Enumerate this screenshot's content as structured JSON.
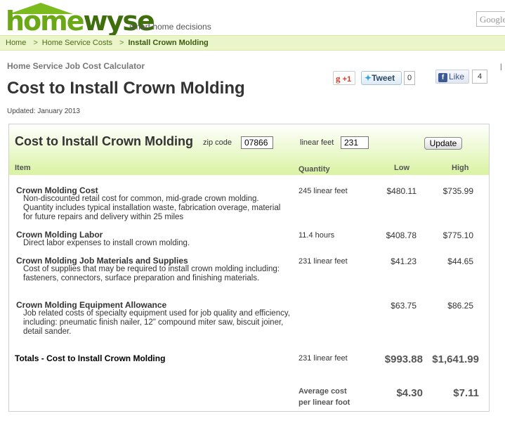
{
  "header": {
    "logo_home": "home",
    "logo_wyse": "wyse",
    "tagline": "smart home decisions",
    "search_placeholder": "Google"
  },
  "breadcrumb": {
    "items": [
      "Home",
      "Home Service Costs",
      "Install Crown Molding"
    ]
  },
  "page": {
    "subtitle": "Home Service Job Cost Calculator",
    "title": "Cost to Install Crown Molding",
    "updated": "Updated: January 2013"
  },
  "social": {
    "gplus_label": "+1",
    "tweet_label": "Tweet",
    "tweet_count": "0",
    "fb_label": "Like",
    "fb_count": "4"
  },
  "calculator": {
    "title": "Cost to Install Crown Molding",
    "zip_label": "zip code",
    "zip_value": "07866",
    "linear_feet_label": "linear feet",
    "linear_feet_value": "231",
    "update_label": "Update",
    "columns": {
      "item": "Item",
      "quantity": "Quantity",
      "low": "Low",
      "high": "High"
    },
    "rows": [
      {
        "name": "Crown Molding Cost",
        "description": "Non-discounted retail cost for common, mid-grade crown molding. Quantity includes typical installation waste, fabrication overage, material for future repairs and delivery within 25 miles",
        "quantity": "245 linear feet",
        "low": "$480.11",
        "high": "$735.99"
      },
      {
        "name": "Crown Molding Labor",
        "description": "Direct labor expenses to install crown molding.",
        "quantity": "11.4 hours",
        "low": "$408.78",
        "high": "$775.10"
      },
      {
        "name": "Crown Molding Job Materials and Supplies",
        "description": "Cost of supplies that may be required to install crown molding including: fasteners, connectors, surface preparation and finishing materials.",
        "quantity": "231 linear feet",
        "low": "$41.23",
        "high": "$44.65"
      },
      {
        "name": "Crown Molding Equipment Allowance",
        "description": "Job related costs of specialty equipment used for job quality and efficiency, including: pneumatic finish nailer, 12\" compound miter saw, biscuit joiner, detail sander.",
        "quantity": "",
        "low": "$63.75",
        "high": "$86.25"
      }
    ],
    "totals": {
      "label": "Totals - Cost to Install Crown Molding",
      "quantity": "231 linear feet",
      "low": "$993.88",
      "high": "$1,641.99"
    },
    "average": {
      "label_line1": "Average cost",
      "label_line2": "per linear foot",
      "low": "$4.30",
      "high": "$7.11"
    }
  },
  "colors": {
    "brand_green": "#6aa816",
    "dark_green": "#3f6e0d",
    "header_gradient_end": "#d9f3a2",
    "breadcrumb_bg": "#eaf5c9"
  }
}
